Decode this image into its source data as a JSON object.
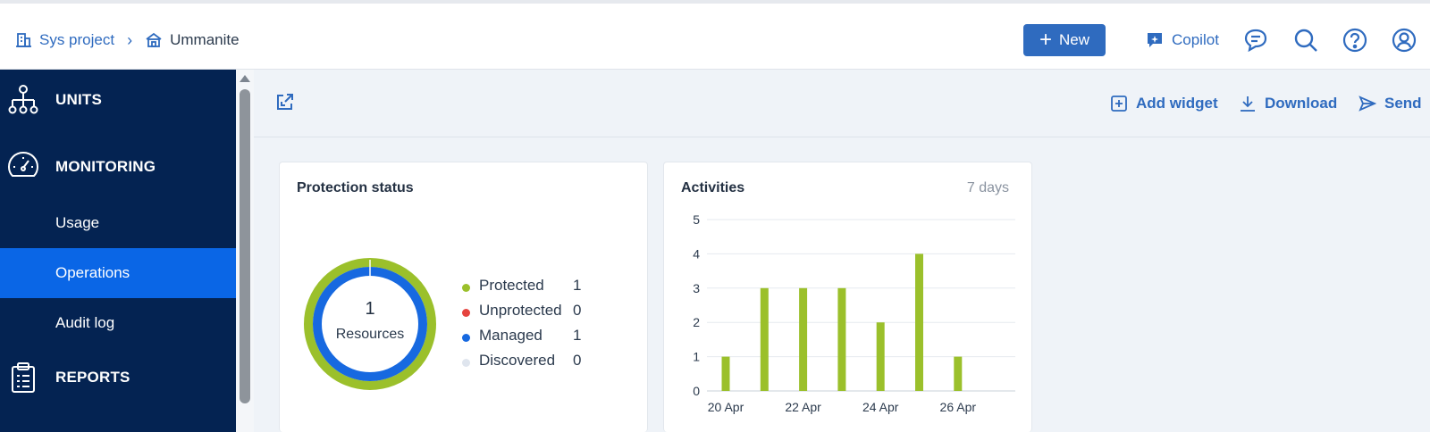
{
  "breadcrumb": {
    "items": [
      {
        "label": "Sys project",
        "icon": "building-icon"
      },
      {
        "label": "Ummanite",
        "icon": "house-icon"
      }
    ]
  },
  "header": {
    "new_label": "New",
    "copilot_label": "Copilot",
    "icons": [
      "chat-icon",
      "search-icon",
      "help-icon",
      "user-icon"
    ]
  },
  "sidebar": {
    "sections": [
      {
        "label": "UNITS",
        "icon": "units-icon"
      },
      {
        "label": "MONITORING",
        "icon": "gauge-icon"
      },
      {
        "label": "REPORTS",
        "icon": "clipboard-icon"
      }
    ],
    "items": [
      {
        "label": "Usage",
        "active": false
      },
      {
        "label": "Operations",
        "active": true
      },
      {
        "label": "Audit log",
        "active": false
      }
    ]
  },
  "toolbar": {
    "add_widget_label": "Add widget",
    "download_label": "Download",
    "send_label": "Send"
  },
  "protection": {
    "title": "Protection status",
    "count": "1",
    "count_label": "Resources",
    "legend": [
      {
        "name": "Protected",
        "value": "1",
        "color": "#9bc02b"
      },
      {
        "name": "Unprotected",
        "value": "0",
        "color": "#e5443f"
      },
      {
        "name": "Managed",
        "value": "1",
        "color": "#1769e0"
      },
      {
        "name": "Discovered",
        "value": "0",
        "color": "#dfe5ee"
      }
    ]
  },
  "activities": {
    "title": "Activities",
    "period": "7 days"
  },
  "chart_data": {
    "type": "bar",
    "title": "Activities",
    "x": [
      "20 Apr",
      "21 Apr",
      "22 Apr",
      "23 Apr",
      "24 Apr",
      "25 Apr",
      "26 Apr"
    ],
    "x_tick_labels": [
      "20 Apr",
      "",
      "22 Apr",
      "",
      "24 Apr",
      "",
      "26 Apr"
    ],
    "values": [
      1,
      3,
      3,
      3,
      2,
      4,
      1
    ],
    "y_ticks": [
      0,
      1,
      2,
      3,
      4,
      5
    ],
    "ylim": [
      0,
      5
    ],
    "grid": true,
    "color": "#9bc02b"
  },
  "colors": {
    "accent": "#2f6bbf",
    "sidebar_bg": "#042352",
    "sidebar_active": "#0a66e6",
    "bar": "#9bc02b"
  }
}
